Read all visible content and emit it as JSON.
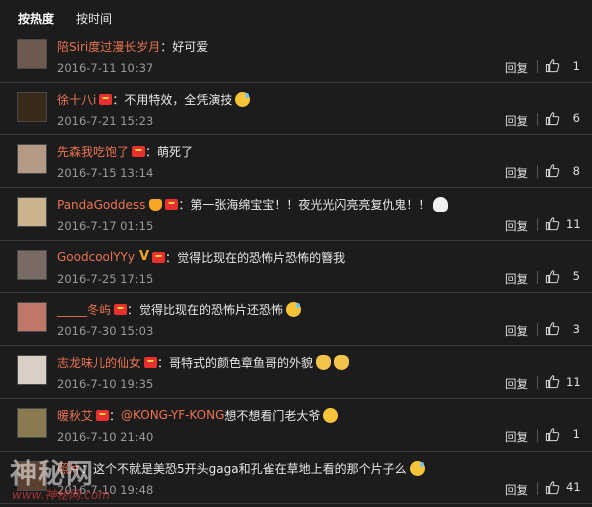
{
  "sort": {
    "hot": "按热度",
    "time": "按时间"
  },
  "labels": {
    "reply": "回复"
  },
  "colors": {
    "background": "#1c1c1c",
    "username": "#eb7350",
    "text": "#e8e8e8",
    "meta": "#9a9a9a"
  },
  "comments": [
    {
      "user": "陪Siri度过漫长岁月",
      "badges": [],
      "text": "好可爱",
      "mention": "",
      "after": "",
      "emoji": [],
      "time": "2016-7-11 10:37",
      "likes": "1",
      "avatar": "#6d5a4e"
    },
    {
      "user": "徐十八i",
      "badges": [
        "member"
      ],
      "text": "不用特效，全凭演技",
      "mention": "",
      "after": "",
      "emoji": [
        "grin-sweat"
      ],
      "time": "2016-7-21 15:23",
      "likes": "6",
      "avatar": "#3a2a1a"
    },
    {
      "user": "先森我吃饱了",
      "badges": [
        "member"
      ],
      "text": "萌死了",
      "mention": "",
      "after": "",
      "emoji": [],
      "time": "2016-7-15 13:14",
      "likes": "8",
      "avatar": "#b59a86"
    },
    {
      "user": "PandaGoddess",
      "badges": [
        "crown",
        "member"
      ],
      "text": "第一张海绵宝宝！！夜光光闪亮亮复仇鬼！！",
      "mention": "",
      "after": "",
      "emoji": [
        "ghost"
      ],
      "time": "2016-7-17 01:15",
      "likes": "11",
      "avatar": "#c9b48e"
    },
    {
      "user": "GoodcoolYYy",
      "badges": [
        "v",
        "member"
      ],
      "text": "觉得比现在的恐怖片恐怖的簪我",
      "mention": "",
      "after": "",
      "emoji": [],
      "time": "2016-7-25 17:15",
      "likes": "5",
      "avatar": "#7a6a64"
    },
    {
      "user": "_____冬屿",
      "badges": [
        "member"
      ],
      "text": "觉得比现在的恐怖片还恐怖",
      "mention": "",
      "after": "",
      "emoji": [
        "sweat"
      ],
      "time": "2016-7-30 15:03",
      "likes": "3",
      "avatar": "#c1766a"
    },
    {
      "user": "志龙味儿的仙女",
      "badges": [
        "member"
      ],
      "text": "哥特式的颜色章鱼哥的外貌",
      "mention": "",
      "after": "",
      "emoji": [
        "cat",
        "cat"
      ],
      "time": "2016-7-10 19:35",
      "likes": "11",
      "avatar": "#d9cfc5"
    },
    {
      "user": "暖秋艾",
      "badges": [
        "member"
      ],
      "text": "",
      "mention": "@KONG-YF-KONG",
      "after": "想不想看门老大爷",
      "emoji": [
        "laugh"
      ],
      "time": "2016-7-10 21:40",
      "likes": "1",
      "avatar": "#8a7a50"
    },
    {
      "user": "照片",
      "badges": [],
      "text": "这个不就是美恐5开头gaga和孔雀在草地上看的那个片子么",
      "mention": "",
      "after": "",
      "emoji": [
        "sweat"
      ],
      "time": "2016-7-10 19:48",
      "likes": "41",
      "avatar": "#5a4030"
    }
  ],
  "watermark": {
    "main": "神秘网",
    "sub": "www.神秘网.com"
  }
}
